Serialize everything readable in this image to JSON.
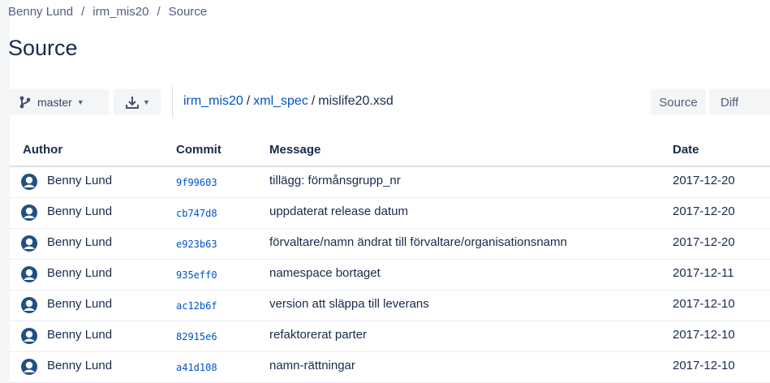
{
  "breadcrumb": [
    "Benny Lund",
    "irm_mis20",
    "Source"
  ],
  "page_title": "Source",
  "toolbar": {
    "branch": "master",
    "branch_icon": "branch-icon",
    "download_icon": "download-icon",
    "path": {
      "repo": "irm_mis20",
      "folder": "xml_spec",
      "file": "mislife20.xsd"
    },
    "source_label": "Source",
    "diff_label": "Diff"
  },
  "table": {
    "headers": {
      "author": "Author",
      "commit": "Commit",
      "message": "Message",
      "date": "Date"
    },
    "rows": [
      {
        "author": "Benny Lund",
        "commit": "9f99603",
        "message": "tillägg: förmånsgrupp_nr",
        "date": "2017-12-20"
      },
      {
        "author": "Benny Lund",
        "commit": "cb747d8",
        "message": "uppdaterat release datum",
        "date": "2017-12-20"
      },
      {
        "author": "Benny Lund",
        "commit": "e923b63",
        "message": "förvaltare/namn ändrat till förvaltare/organisationsnamn",
        "date": "2017-12-20"
      },
      {
        "author": "Benny Lund",
        "commit": "935eff0",
        "message": "namespace bortaget",
        "date": "2017-12-11"
      },
      {
        "author": "Benny Lund",
        "commit": "ac12b6f",
        "message": "version att släppa till leverans",
        "date": "2017-12-10"
      },
      {
        "author": "Benny Lund",
        "commit": "82915e6",
        "message": "refaktorerat parter",
        "date": "2017-12-10"
      },
      {
        "author": "Benny Lund",
        "commit": "a41d108",
        "message": "namn-rättningar",
        "date": "2017-12-10"
      }
    ]
  },
  "colors": {
    "link": "#0052cc",
    "text": "#172b4d",
    "button_bg": "#f4f5f7",
    "avatar": "#205081"
  }
}
